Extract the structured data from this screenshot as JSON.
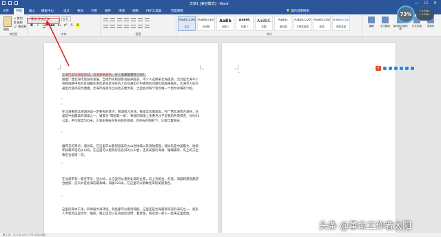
{
  "window": {
    "title": "文档1 [兼容模式] - Word",
    "minimize": "—",
    "maximize": "☐",
    "close": "✕"
  },
  "tabs": [
    "文件",
    "开始",
    "插入",
    "模板中心",
    "设计",
    "布局",
    "引用",
    "邮件",
    "审阅",
    "视图",
    "PDF工具集",
    "百度网盘"
  ],
  "active_tab": "开始",
  "tell_me": "操作说明搜索",
  "clipboard": {
    "paste": "粘贴",
    "cut": "剪切",
    "copy": "复制",
    "format_painter": "格式刷",
    "label": "剪贴板"
  },
  "font": {
    "name": "等线 (中文正文)",
    "size": "五号",
    "format_buttons": [
      "B",
      "I",
      "U",
      "abc",
      "x₂",
      "x²",
      "A",
      "A"
    ],
    "label": "字体"
  },
  "paragraph": {
    "label": "段落"
  },
  "styles": {
    "items": [
      {
        "sample": "AaBbCcDd",
        "name": "正文"
      },
      {
        "sample": "AaBbCcDd",
        "name": "无间隔"
      },
      {
        "sample": "AaBb",
        "name": "标题 1"
      },
      {
        "sample": "AaBbC",
        "name": "标题 2"
      },
      {
        "sample": "AaBbC",
        "name": "标题"
      },
      {
        "sample": "AaBbC",
        "name": "副标题"
      },
      {
        "sample": "AaBbCcDd",
        "name": "不明显强调"
      },
      {
        "sample": "AaBbCcDd",
        "name": "强调"
      },
      {
        "sample": "AaBbCcDd",
        "name": "明显强调"
      }
    ],
    "label": "样式"
  },
  "ribbon_right": [
    {
      "label": "编辑"
    },
    {
      "label": "全文翻译"
    },
    {
      "label": "保存到百度网盘"
    },
    {
      "label": "论文查重"
    },
    {
      "label": "加载项"
    }
  ],
  "perf_widget": {
    "percent": "73%",
    "up": "↑ 0.4K/s",
    "down": "↓ 1.2K/s"
  },
  "document": {
    "highlighted_line": "北海市是滨海旅游城，滨海越来越热，来了",
    "highlighted_tail": "选择旅游地了吗？",
    "paragraphs": [
      "随着广西北海市旅游的发展，当地市民和游客也越来越多。不少人选择来北海旅游，尤其是北海不少地铁线路中有的区域都在景区游览区域有的人的交通出行中遇到的问题也就越来越多，北海市人的交通出行变得较为便捷，北海市各景点之间也方便大家，之后会对每个景点做一个更为详细的介绍。",
      "在北海来到北海涠洲岛一定要去的景点：银滩和九弯湾。银滩又叫南珠岛，在广西北海市合浦县，这里是中国最美的海滩之一，被誉为“南国第一滩”，银滩因海滩上金黄色沙子呈银白色而得名，长约24公里，平均宽度500米，沙滩主要由白色石英砂组成，在阳光的照射下，沙滩泛着银光。",
      "推荐去的景点：涠洲岛。在这里可以看到很美的火山岩地貌以及海蚀景观，涠洲岛是中国最大、地质年龄最年轻的火山岛，在这里可以看到形态各异的火山岩，还有美丽的海滩、珊瑚礁等，岛上的天主教堂也值得一去。",
      "在北海市有一家老字号，冠头岭，从这里可以看到北海的全景，岛上有炮台、灯塔，清晨和黄昏都适合拍照，冠头岭是北海的最高峰，海拔120米，在这里可以俯瞰北海的美丽景色。",
      "这里的海水干净，四周被大海环绕，到处都可以看到海鸥，这里还是北海最受欢迎的海岛之一，很多人专程到这里玩水、拍照，晚上还可以在海边吃烧烤、看星星，很适合一家人一起来这里度假。"
    ]
  },
  "status_bar": "第 1 页，共 2 页    1071 个字    中文(中国)",
  "sogou": "S",
  "watermark": "头条 @革命工作者太阳"
}
